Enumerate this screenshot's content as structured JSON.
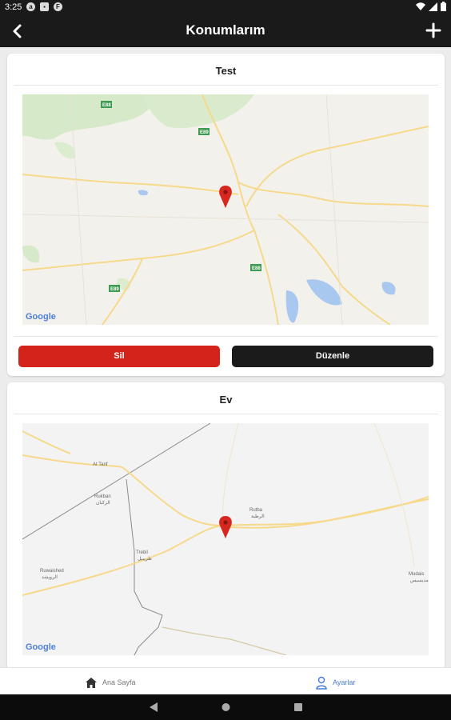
{
  "status": {
    "time": "3:25",
    "notification_icons": [
      "a",
      "▪",
      "F"
    ]
  },
  "header": {
    "title": "Konumlarım"
  },
  "locations": [
    {
      "name": "Test",
      "map_labels": [
        "E88",
        "E89",
        "E88",
        "E89"
      ],
      "delete_label": "Sil",
      "edit_label": "Düzenle"
    },
    {
      "name": "Ev",
      "map_labels": [
        "At Tanf",
        "Rukban",
        "الركبان",
        "Trebil",
        "طريبيل",
        "Ruwaished",
        "الرويشد",
        "Rutba",
        "الرطبة",
        "Mudais",
        "مديسيس"
      ]
    }
  ],
  "map_watermark": "Google",
  "bottom_nav": {
    "home_label": "Ana Sayfa",
    "settings_label": "Ayarlar"
  },
  "colors": {
    "primary_dark": "#1a1a1a",
    "danger": "#d3231a",
    "accent_blue": "#4a7be0"
  }
}
